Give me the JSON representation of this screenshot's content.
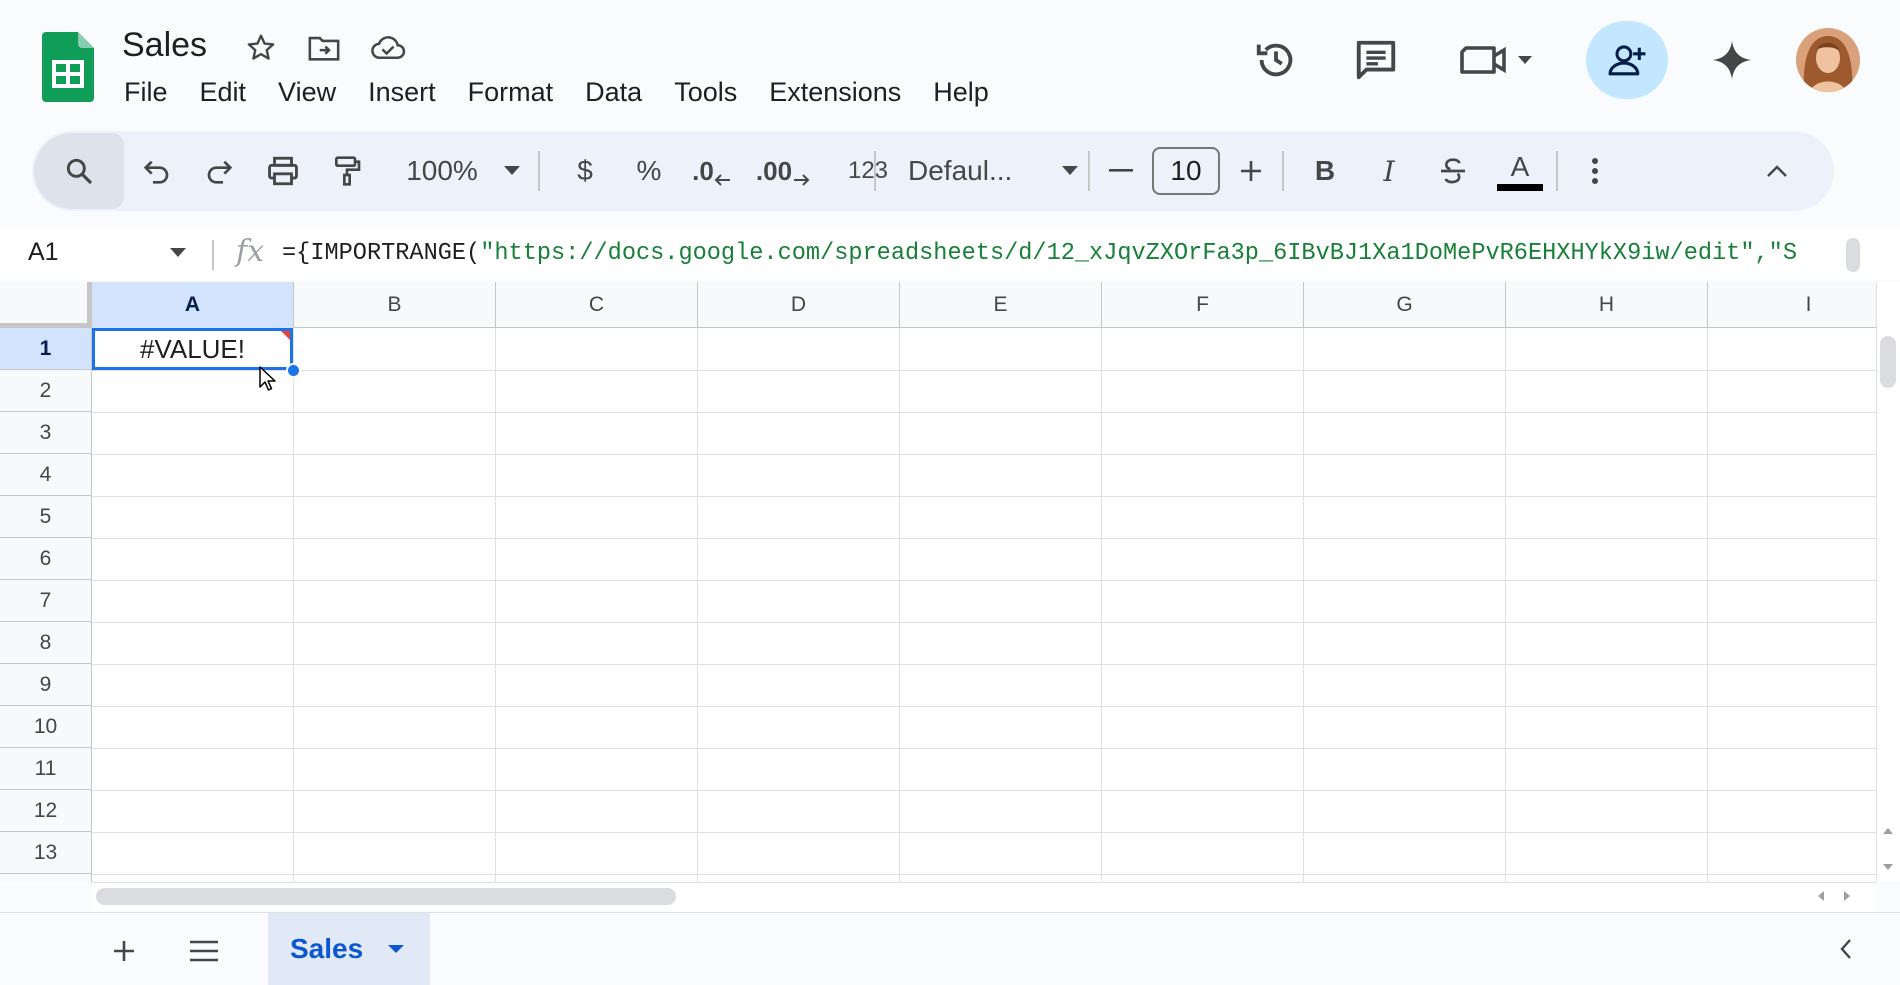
{
  "app": {
    "title": "Sales",
    "menu": [
      "File",
      "Edit",
      "View",
      "Insert",
      "Format",
      "Data",
      "Tools",
      "Extensions",
      "Help"
    ]
  },
  "toolbar": {
    "zoom": "100%",
    "currency": "$",
    "percent": "%",
    "decrease_decimal": ".0",
    "increase_decimal": ".00",
    "number_format": "123",
    "font": "Defaul...",
    "font_size": "10",
    "bold": "B",
    "italic": "I",
    "text_color_letter": "A",
    "text_color": "#000000"
  },
  "formula_bar": {
    "cell_ref": "A1",
    "fx": "fx",
    "formula_prefix": "={IMPORTRANGE(",
    "formula_string": "\"https://docs.google.com/spreadsheets/d/12_xJqvZXOrFa3p_6IBvBJ1Xa1DoMePvR6EHXHYkX9iw/edit\",\"S"
  },
  "grid": {
    "columns": [
      "A",
      "B",
      "C",
      "D",
      "E",
      "F",
      "G",
      "H",
      "I"
    ],
    "rows": [
      "1",
      "2",
      "3",
      "4",
      "5",
      "6",
      "7",
      "8",
      "9",
      "10",
      "11",
      "12",
      "13"
    ],
    "selected_column": "A",
    "selected_row": "1",
    "cells": {
      "A1": "#VALUE!"
    }
  },
  "sheets": {
    "tabs": [
      "Sales"
    ],
    "active": "Sales"
  },
  "colors": {
    "accent": "#1a73e8",
    "share_bg": "#c2e7ff",
    "sheets_green": "#0f9d58",
    "formula_string": "#188038",
    "error_marker": "#e94235"
  }
}
